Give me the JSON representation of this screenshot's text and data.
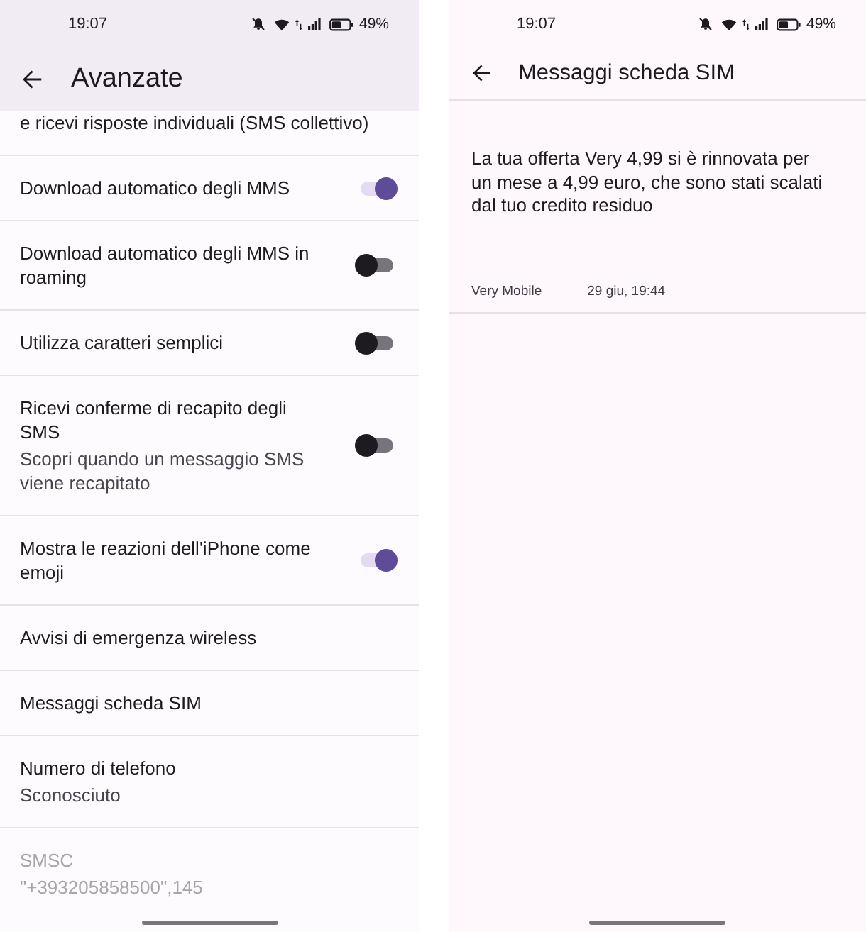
{
  "settings_screen": {
    "status_bar": {
      "time": "19:07",
      "battery": "49%"
    },
    "app_bar": {
      "title": "Avanzate"
    },
    "items": [
      {
        "kind": "plain",
        "title": "e ricevi risposte individuali (SMS collettivo)",
        "disabled": false
      },
      {
        "kind": "switch",
        "title": "Download automatico degli MMS",
        "on": true,
        "disabled": false
      },
      {
        "kind": "switch",
        "title": "Download automatico degli MMS in roaming",
        "on": false,
        "disabled": false
      },
      {
        "kind": "switch",
        "title": "Utilizza caratteri semplici",
        "on": false,
        "disabled": false
      },
      {
        "kind": "switch",
        "title": "Ricevi conferme di recapito degli SMS",
        "subtitle": "Scopri quando un messaggio SMS viene recapitato",
        "on": false,
        "disabled": false
      },
      {
        "kind": "switch",
        "title": "Mostra le reazioni dell'iPhone come emoji",
        "on": true,
        "disabled": false
      },
      {
        "kind": "plain",
        "title": "Avvisi di emergenza wireless",
        "disabled": false
      },
      {
        "kind": "plain",
        "title": "Messaggi scheda SIM",
        "disabled": false
      },
      {
        "kind": "plain",
        "title": "Numero di telefono",
        "subtitle": "Sconosciuto",
        "disabled": false
      },
      {
        "kind": "plain",
        "title": "SMSC",
        "subtitle": "\"+393205858500\",145",
        "disabled": true
      }
    ]
  },
  "sim_messages_screen": {
    "status_bar": {
      "time": "19:07",
      "battery": "49%"
    },
    "app_bar": {
      "title": "Messaggi scheda SIM"
    },
    "messages": [
      {
        "text": "La tua offerta Very 4,99 si è rinnovata per un mese a 4,99 euro, che sono stati scalati dal tuo credito residuo",
        "sender": "Very Mobile",
        "time": "29 giu, 19:44"
      }
    ]
  }
}
